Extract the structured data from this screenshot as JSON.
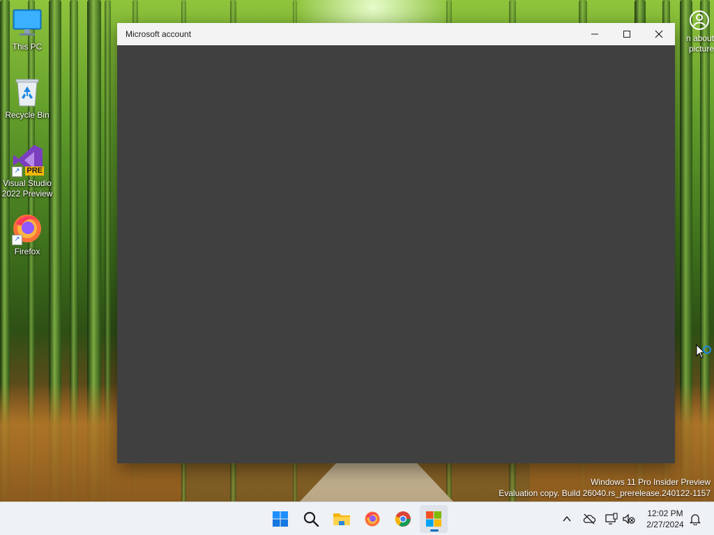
{
  "desktop": {
    "icons": [
      {
        "label": "This PC",
        "icon": "monitor-icon"
      },
      {
        "label": "Recycle Bin",
        "icon": "recycle-bin-icon"
      },
      {
        "label": "Visual Studio 2022 Preview",
        "icon": "visual-studio-icon",
        "badge": "PRE"
      },
      {
        "label": "Firefox",
        "icon": "firefox-icon"
      }
    ],
    "learn_about_text": "n about picture"
  },
  "window": {
    "title": "Microsoft account",
    "controls": [
      "minimize-icon",
      "maximize-icon",
      "close-icon"
    ],
    "content_color": "#404040"
  },
  "watermark": {
    "line1": "Windows 11 Pro Insider Preview",
    "line2": "Evaluation copy. Build 26040.rs_prerelease.240122-1157"
  },
  "taskbar": {
    "apps": [
      {
        "name": "Start",
        "icon": "windows-start-icon"
      },
      {
        "name": "Search",
        "icon": "search-icon"
      },
      {
        "name": "File Explorer",
        "icon": "folder-icon"
      },
      {
        "name": "Firefox",
        "icon": "firefox-icon"
      },
      {
        "name": "Chrome",
        "icon": "chrome-icon"
      },
      {
        "name": "Microsoft Store",
        "icon": "microsoft-logo-icon",
        "active": true
      }
    ],
    "tray": {
      "icons": [
        "chevron-up-icon",
        "cloud-offline-icon",
        "display-icon",
        "volume-muted-icon"
      ],
      "time": "12:02 PM",
      "date": "2/27/2024"
    }
  },
  "colors": {
    "accent": "#0f6cbd",
    "taskbar_bg": "#eef1f5",
    "titlebar_bg": "#f3f3f3",
    "window_content": "#404040"
  }
}
